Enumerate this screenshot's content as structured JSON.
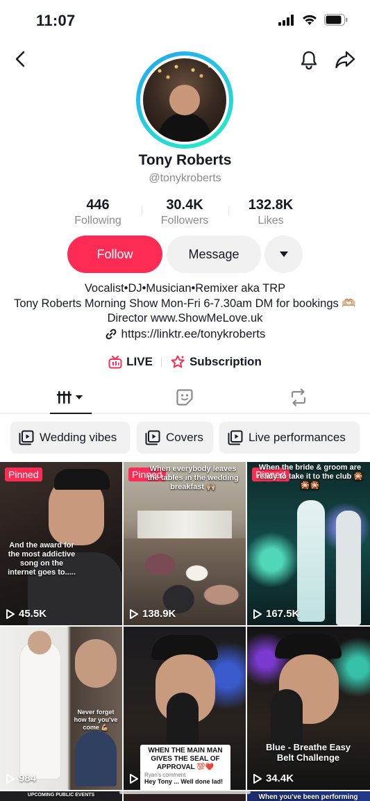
{
  "status_bar": {
    "time": "11:07"
  },
  "profile": {
    "name": "Tony Roberts",
    "handle": "@tonykroberts",
    "stats": [
      {
        "value": "446",
        "label": "Following"
      },
      {
        "value": "30.4K",
        "label": "Followers"
      },
      {
        "value": "132.8K",
        "label": "Likes"
      }
    ],
    "follow_label": "Follow",
    "message_label": "Message",
    "bio": "Vocalist•DJ•Musician•Remixer aka TRP\nTony Roberts Morning Show Mon-Fri 6-7.30am DM for bookings 🫶🏼 Director www.ShowMeLove.uk",
    "link": "https://linktr.ee/tonykroberts",
    "live_label": "LIVE",
    "subscription_label": "Subscription"
  },
  "playlists": [
    {
      "label": "Wedding vibes"
    },
    {
      "label": "Covers"
    },
    {
      "label": "Live performances"
    }
  ],
  "videos": [
    {
      "pinned": "Pinned",
      "views": "45.5K",
      "caption": "And the award for the most addictive song on the internet goes to....."
    },
    {
      "pinned": "Pinned",
      "views": "138.9K",
      "caption": "When everybody leaves the tables in the wedding breakfast 🙌🏼"
    },
    {
      "pinned": "Pinned",
      "views": "167.5K",
      "caption": "When the bride & groom are ready to take it to the club 🎇🎇🎇"
    },
    {
      "views": "984",
      "caption": "Never forget how far you've come 💪🏼"
    },
    {
      "views": "",
      "caption": "WHEN THE MAIN MAN GIVES THE SEAL OF APPROVAL 💯❤️",
      "comment_head": "Ryan's comment",
      "comment_body": "Hey Tony ... Well done lad!"
    },
    {
      "views": "34.4K",
      "caption": "Blue - Breathe Easy Belt Challenge"
    },
    {
      "caption": "UPCOMING PUBLIC EVENTS"
    },
    {
      "caption": ""
    },
    {
      "caption": "When you've been performing"
    }
  ],
  "colors": {
    "accent": "#fe2c55",
    "ring_start": "#1ea6f2",
    "ring_end": "#25f0c0"
  }
}
